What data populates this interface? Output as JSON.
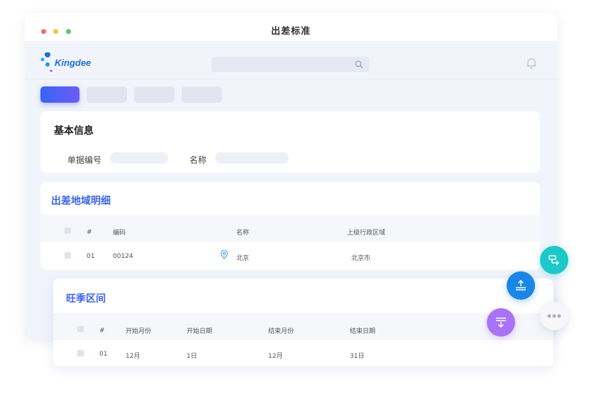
{
  "window": {
    "title": "出差标准"
  },
  "app": {
    "logo_text": "Kingdee",
    "search": {
      "placeholder": ""
    }
  },
  "tabs": [
    {
      "label": ""
    },
    {
      "label": ""
    },
    {
      "label": ""
    },
    {
      "label": ""
    }
  ],
  "basic_info": {
    "title": "基本信息",
    "fields": [
      {
        "label": "单据编号",
        "value": ""
      },
      {
        "label": "名称",
        "value": ""
      }
    ]
  },
  "region_detail": {
    "title": "出差地域明细",
    "columns": [
      "#",
      "编码",
      "名称",
      "上级行政区域"
    ],
    "rows": [
      {
        "index": "01",
        "code": "00124",
        "name": "北京",
        "parent": "北京市"
      }
    ]
  },
  "peak_season": {
    "title": "旺季区间",
    "columns": [
      "#",
      "开始月份",
      "开始日期",
      "结束月份",
      "结束日期"
    ],
    "rows": [
      {
        "index": "01",
        "start_month": "12月",
        "start_day": "1日",
        "end_month": "12月",
        "end_day": "31日"
      }
    ]
  },
  "colors": {
    "accent": "#3a63f5",
    "section_title": "#3d66e8",
    "fab_teal": "#1cc8c8",
    "fab_blue": "#1a86e6",
    "fab_purple": "#a873f5"
  }
}
